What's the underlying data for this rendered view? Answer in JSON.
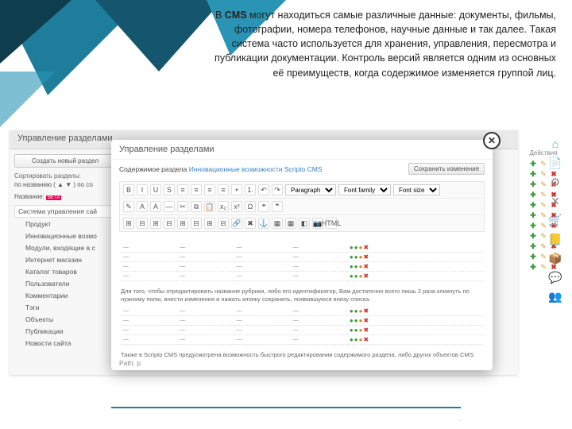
{
  "intro": {
    "prefix": "В ",
    "bold": "CMS",
    "text": " могут находиться самые различные данные: документы, фильмы, фотографии, номера телефонов, научные данные и так далее. Такая система часто используется для хранения, управления, пересмотра и публикации документации. Контроль версий является одним из основных её преимуществ, когда содержимое изменяется группой лиц."
  },
  "screenshot": {
    "header": "Управление разделами",
    "create_btn": "Создать новый раздел",
    "sort_label": "Сортировать разделы:",
    "sort_value": "по названию ( ▲ ▼ )  по со",
    "filter_label": "Название:",
    "beta": "BETA",
    "tree": [
      "Система управления сай",
      "Продукт",
      "Инновационные возмо",
      "Модули, входящие в с",
      "Интернет магазин",
      "Каталог товаров",
      "Пользователи",
      "Комментарии",
      "Тэги",
      "Объекты",
      "Публикации",
      "Новости сайта"
    ],
    "actions_title": "Действия"
  },
  "modal": {
    "title": "Управление разделами",
    "sub_label": "Содержимое раздела",
    "sub_value": "Инновационные возможности Scripto CMS",
    "save": "Сохранить изменения",
    "toolbar": {
      "row1": [
        "B",
        "I",
        "U",
        "S",
        "≡",
        "≡",
        "≡",
        "≡",
        "•",
        "1.",
        "↶",
        "↷"
      ],
      "selects": [
        "Paragraph",
        "Font family",
        "Font size"
      ],
      "row2": [
        "✎",
        "A",
        "A",
        "—",
        "✂",
        "⧉",
        "📋",
        "x₂",
        "x²",
        "Ω",
        "❝",
        "❞"
      ],
      "row3": [
        "⊞",
        "⊟",
        "⊞",
        "⊟",
        "⊞",
        "⊟",
        "⊞",
        "⊟",
        "🔗",
        "✖",
        "⚓",
        "▦",
        "▦",
        "◧",
        "📷",
        "HTML"
      ]
    },
    "table_rows": [
      "",
      "",
      "",
      ""
    ],
    "note1": "Для того, чтобы отредактировать название рубрики, либо его идентификатор, Вам достаточно всего лишь 2 раза кликнуть по нужному полю, внести изменения и нажать кнопку сохранить, появившуюся внизу списка.",
    "note2": "Также в Scripto CMS предусмотрена возможность быстрого редактирования содержимого раздела, либо других объектов CMS:",
    "path": "Path: p"
  },
  "footer": "."
}
